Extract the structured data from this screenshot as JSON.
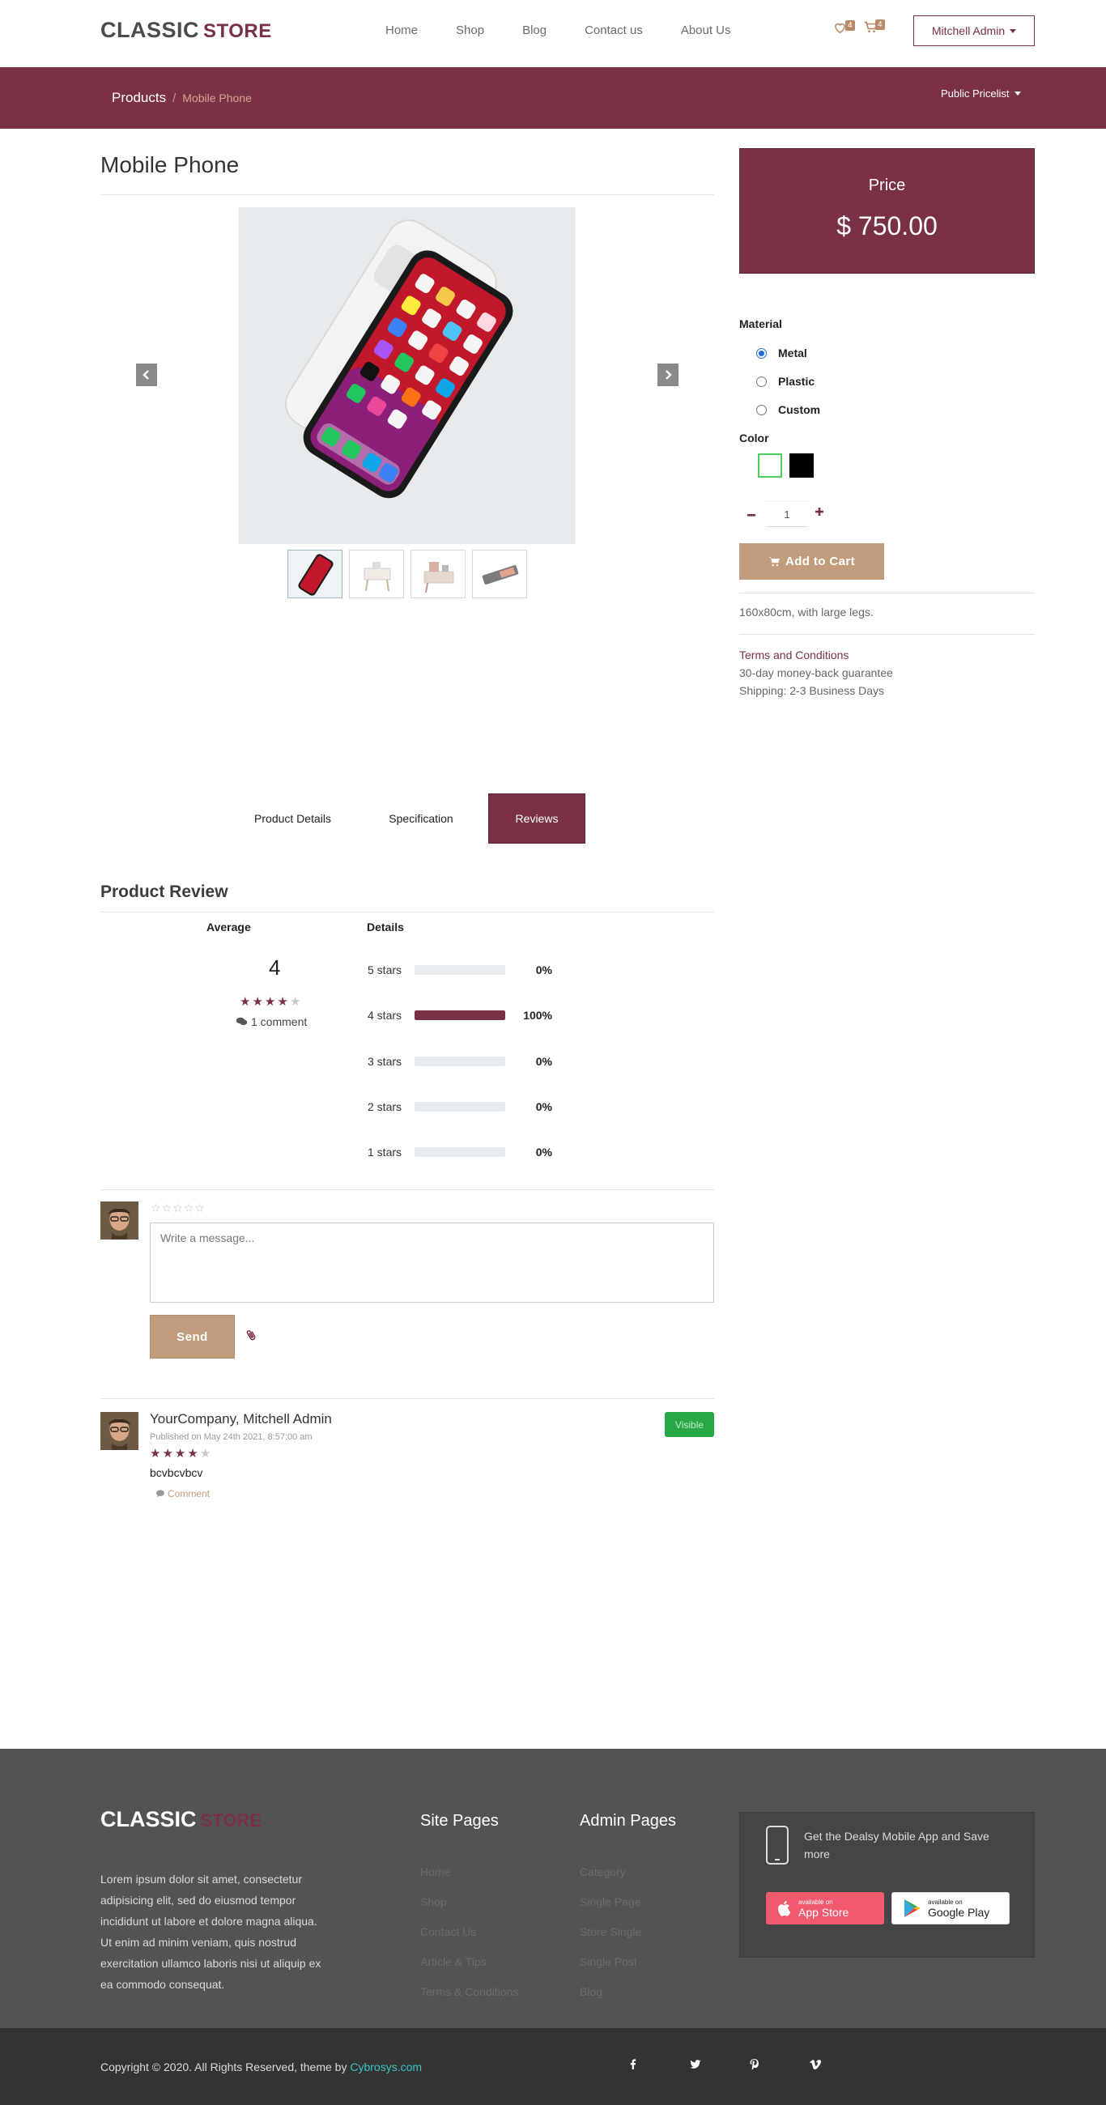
{
  "header": {
    "logo_classic": "CLASSIC",
    "logo_store": "STORE",
    "nav": [
      "Home",
      "Shop",
      "Blog",
      "Contact us",
      "About Us"
    ],
    "wishlist_count": "4",
    "cart_count": "4",
    "user_label": "Mitchell Admin"
  },
  "breadcrumb": {
    "root": "Products",
    "separator": "/",
    "current": "Mobile Phone",
    "pricelist": "Public Pricelist"
  },
  "product": {
    "title": "Mobile Phone",
    "price_label": "Price",
    "price": "$ 750.00",
    "material_label": "Material",
    "materials": [
      "Metal",
      "Plastic",
      "Custom"
    ],
    "material_selected": "Metal",
    "color_label": "Color",
    "colors": [
      "#ffffff",
      "#000000"
    ],
    "quantity": "1",
    "add_to_cart": "Add to Cart",
    "description": "160x80cm, with large legs.",
    "terms_link": "Terms and Conditions",
    "guarantee": "30-day money-back guarantee",
    "shipping": "Shipping: 2-3 Business Days"
  },
  "tabs": [
    "Product Details",
    "Specification",
    "Reviews"
  ],
  "active_tab": "Reviews",
  "reviews": {
    "title": "Product Review",
    "average_header": "Average",
    "details_header": "Details",
    "average": "4",
    "average_rating": 4,
    "comment_count": "1 comment",
    "breakdown": [
      {
        "label": "5 stars",
        "percent": "0%",
        "fraction": 0
      },
      {
        "label": "4 stars",
        "percent": "100%",
        "fraction": 1
      },
      {
        "label": "3 stars",
        "percent": "0%",
        "fraction": 0
      },
      {
        "label": "2 stars",
        "percent": "0%",
        "fraction": 0
      },
      {
        "label": "1 stars",
        "percent": "0%",
        "fraction": 0
      }
    ],
    "message_placeholder": "Write a message...",
    "send_label": "Send",
    "comment": {
      "author": "YourCompany, Mitchell Admin",
      "published": "Published on May 24th 2021, 8:57:00 am",
      "rating": 4,
      "text": "bcvbcvbcv",
      "action": "Comment",
      "status": "Visible"
    }
  },
  "footer": {
    "logo_classic": "CLASSIC",
    "logo_store": "STORE",
    "about": "Lorem ipsum dolor sit amet, consectetur adipisicing elit, sed do eiusmod tempor incididunt ut labore et dolore magna aliqua. Ut enim ad minim veniam, quis nostrud exercitation ullamco laboris nisi ut aliquip ex ea commodo consequat.",
    "site_pages_title": "Site Pages",
    "site_pages": [
      "Home",
      "Shop",
      "Contact Us",
      "Article & Tips",
      "Terms & Conditions"
    ],
    "admin_pages_title": "Admin Pages",
    "admin_pages": [
      "Category",
      "Single Page",
      "Store Single",
      "Single Post",
      "Blog"
    ],
    "app_text": "Get the Dealsy Mobile App and Save more",
    "appstore_small": "available on",
    "appstore_big": "App Store",
    "googleplay_small": "available on",
    "googleplay_big": "Google Play",
    "copyright": "Copyright © 2020. All Rights Reserved, theme by",
    "copyright_brand": "Cybrosys.com",
    "socials": [
      "f",
      "twitter",
      "p",
      "v"
    ]
  },
  "colors": {
    "brand": "#7a3045",
    "accent": "#c19d7e",
    "success": "#28a745",
    "footer_bg": "#535353",
    "bottom_bar_bg": "#333333"
  }
}
